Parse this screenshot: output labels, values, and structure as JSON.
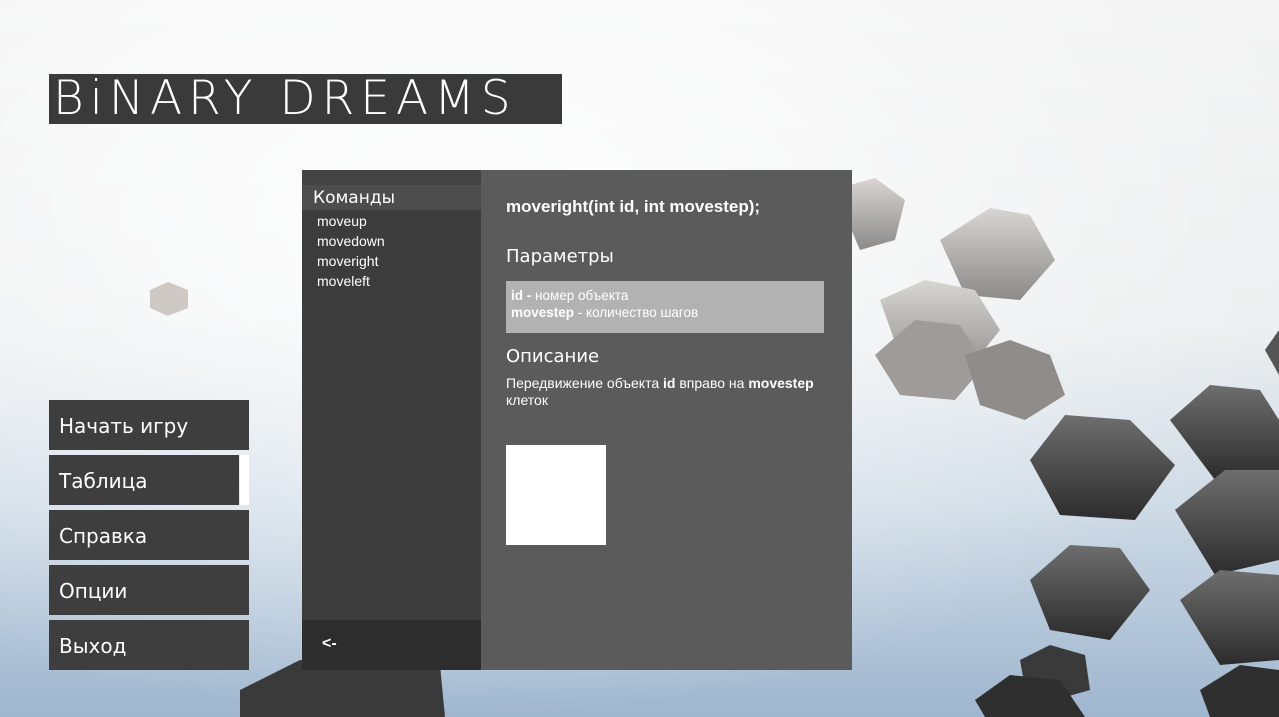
{
  "app": {
    "logo_text": "BiNARY DREAMS"
  },
  "main_menu": {
    "items": [
      {
        "label": "Начать игру"
      },
      {
        "label": "Таблица лидеров"
      },
      {
        "label": "Справка"
      },
      {
        "label": "Опции"
      },
      {
        "label": "Выход"
      }
    ]
  },
  "help": {
    "commands_header": "Команды",
    "commands": [
      "moveup",
      "movedown",
      "moveright",
      "moveleft"
    ],
    "back_label": "<-",
    "selected_signature": "moveright(int id, int movestep);",
    "params_title": "Параметры",
    "params": [
      {
        "name": "id",
        "sep": " - ",
        "text": "номер объекта"
      },
      {
        "name": "movestep",
        "sep": " - ",
        "text": "количество шагов"
      }
    ],
    "description_title": "Описание",
    "description": {
      "part1": "Передвижение объекта ",
      "bold1": "id",
      "part2": " вправо на ",
      "bold2": "movestep",
      "part3": " клеток"
    }
  },
  "colors": {
    "panel_bg": "#5b5b5b",
    "list_bg": "#3c3c3c",
    "button_bg": "#3e3e3e",
    "params_bg": "#b2b2b2"
  }
}
